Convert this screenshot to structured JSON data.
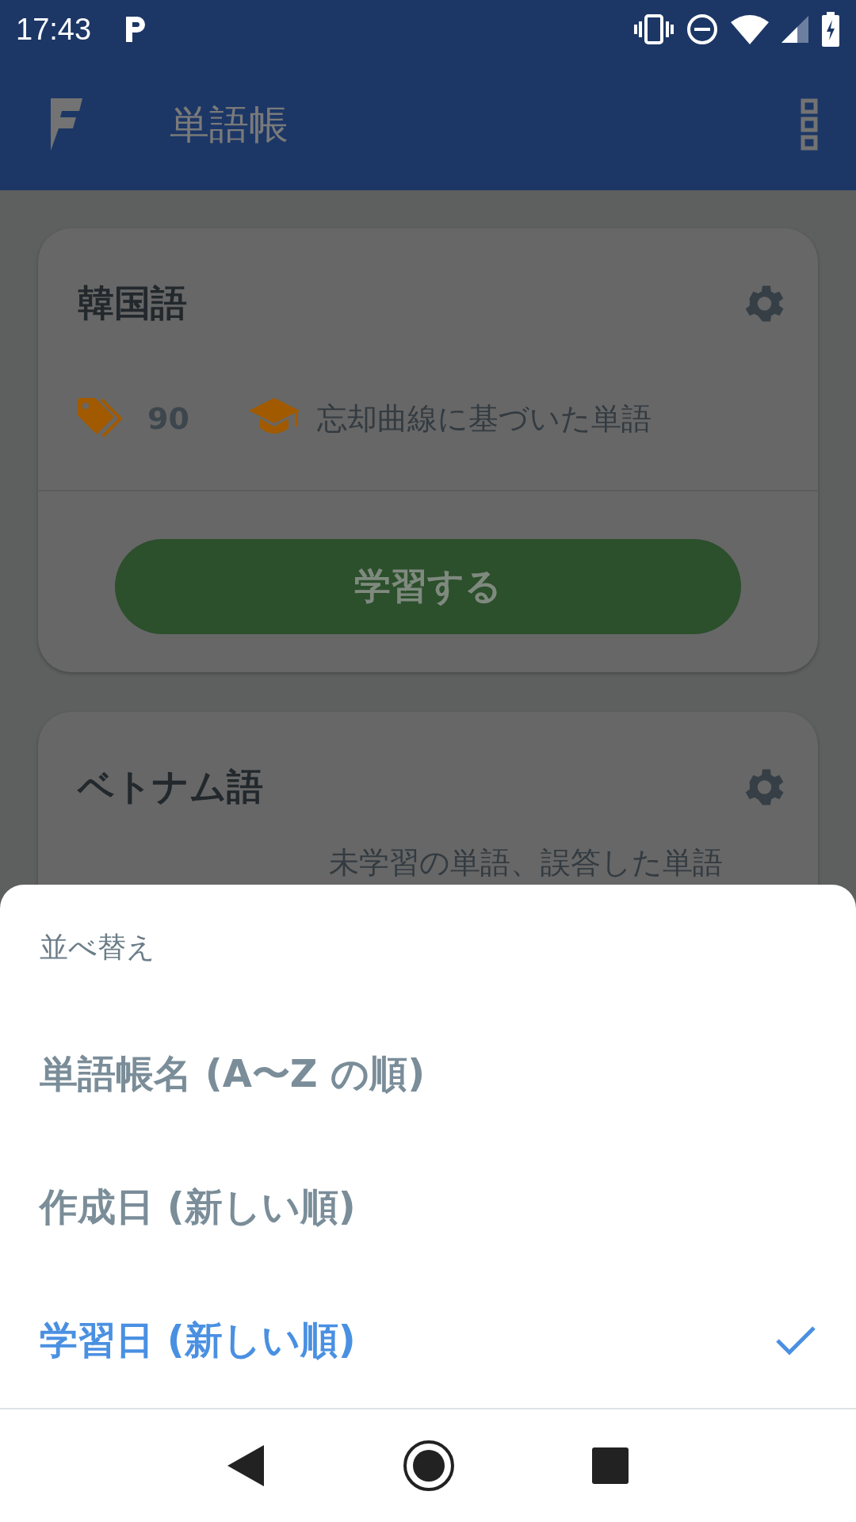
{
  "status_bar": {
    "time": "17:43"
  },
  "app_bar": {
    "title": "単語帳"
  },
  "decks": [
    {
      "name": "韓国語",
      "count": "90",
      "mode": "忘却曲線に基づいた単語",
      "button": "学習する"
    },
    {
      "name": "ベトナム語",
      "mode": "未学習の単語、誤答した単語"
    }
  ],
  "sort_sheet": {
    "title": "並べ替え",
    "options": [
      {
        "label": "単語帳名 (A〜Z の順)",
        "selected": false
      },
      {
        "label": "作成日 (新しい順)",
        "selected": false
      },
      {
        "label": "学習日 (新しい順)",
        "selected": true
      }
    ]
  }
}
